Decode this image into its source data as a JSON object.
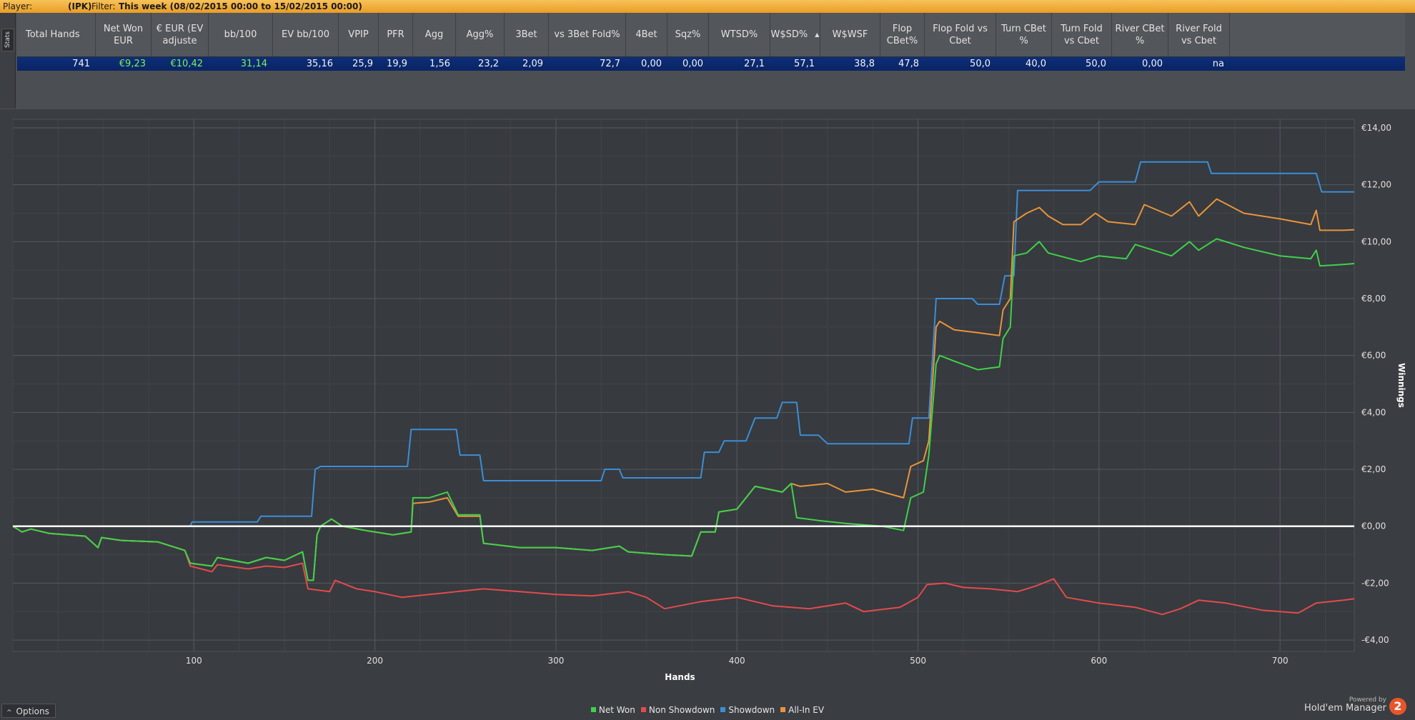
{
  "filter_bar": {
    "player_label": "Player:",
    "player_value": "(IPK)",
    "filter_label": "Filter:",
    "filter_value": "This week (08/02/2015 00:00 to 15/02/2015 00:00)"
  },
  "stats_tab_label": "Stats",
  "stats_table": {
    "columns": [
      {
        "label": "Total Hands",
        "value": "741",
        "green": false
      },
      {
        "label": "Net Won EUR",
        "value": "€9,23",
        "green": true
      },
      {
        "label": "€ EUR (EV adjuste",
        "value": "€10,42",
        "green": true
      },
      {
        "label": "bb/100",
        "value": "31,14",
        "green": true
      },
      {
        "label": "EV bb/100",
        "value": "35,16",
        "green": false
      },
      {
        "label": "VPIP",
        "value": "25,9",
        "green": false
      },
      {
        "label": "PFR",
        "value": "19,9",
        "green": false
      },
      {
        "label": "Agg",
        "value": "1,56",
        "green": false
      },
      {
        "label": "Agg%",
        "value": "23,2",
        "green": false
      },
      {
        "label": "3Bet",
        "value": "2,09",
        "green": false
      },
      {
        "label": "vs 3Bet Fold%",
        "value": "72,7",
        "green": false
      },
      {
        "label": "4Bet",
        "value": "0,00",
        "green": false
      },
      {
        "label": "Sqz%",
        "value": "0,00",
        "green": false
      },
      {
        "label": "WTSD%",
        "value": "27,1",
        "green": false
      },
      {
        "label": "W$SD%",
        "value": "57,1",
        "green": false
      },
      {
        "label": "W$WSF",
        "value": "38,8",
        "green": false
      },
      {
        "label": "Flop CBet%",
        "value": "47,8",
        "green": false
      },
      {
        "label": "Flop Fold vs Cbet",
        "value": "50,0",
        "green": false
      },
      {
        "label": "Turn CBet %",
        "value": "40,0",
        "green": false
      },
      {
        "label": "Turn Fold vs Cbet",
        "value": "50,0",
        "green": false
      },
      {
        "label": "River CBet %",
        "value": "0,00",
        "green": false
      },
      {
        "label": "River Fold vs Cbet",
        "value": "na",
        "green": false
      }
    ]
  },
  "chart_data": {
    "type": "line",
    "title": "",
    "xlabel": "Hands",
    "ylabel": "Winnings",
    "xlim": [
      0,
      741
    ],
    "ylim": [
      -4.4,
      14.3
    ],
    "x_ticks": [
      100,
      200,
      300,
      400,
      500,
      600,
      700
    ],
    "y_ticks": [
      {
        "v": 14,
        "label": "€14,00"
      },
      {
        "v": 12,
        "label": "€12,00"
      },
      {
        "v": 10,
        "label": "€10,00"
      },
      {
        "v": 8,
        "label": "€8,00"
      },
      {
        "v": 6,
        "label": "€6,00"
      },
      {
        "v": 4,
        "label": "€4,00"
      },
      {
        "v": 2,
        "label": "€2,00"
      },
      {
        "v": 0,
        "label": "€0,00"
      },
      {
        "v": -2,
        "label": "-€2,00"
      },
      {
        "v": -4,
        "label": "-€4,00"
      }
    ],
    "grid": true,
    "legend_position": "bottom",
    "series": [
      {
        "name": "Net Won",
        "color": "#3fd14a",
        "points": [
          [
            0,
            0
          ],
          [
            5,
            -0.2
          ],
          [
            10,
            -0.1
          ],
          [
            20,
            -0.25
          ],
          [
            40,
            -0.35
          ],
          [
            47,
            -0.75
          ],
          [
            49,
            -0.4
          ],
          [
            60,
            -0.5
          ],
          [
            80,
            -0.55
          ],
          [
            95,
            -0.85
          ],
          [
            98,
            -1.3
          ],
          [
            110,
            -1.4
          ],
          [
            113,
            -1.1
          ],
          [
            130,
            -1.3
          ],
          [
            140,
            -1.1
          ],
          [
            150,
            -1.2
          ],
          [
            160,
            -0.9
          ],
          [
            163,
            -1.9
          ],
          [
            166,
            -1.9
          ],
          [
            168,
            -0.3
          ],
          [
            170,
            0.0
          ],
          [
            176,
            0.25
          ],
          [
            182,
            0.0
          ],
          [
            195,
            -0.15
          ],
          [
            210,
            -0.3
          ],
          [
            220,
            -0.2
          ],
          [
            221,
            1.0
          ],
          [
            230,
            1.0
          ],
          [
            240,
            1.2
          ],
          [
            246,
            0.4
          ],
          [
            258,
            0.4
          ],
          [
            260,
            -0.6
          ],
          [
            280,
            -0.75
          ],
          [
            300,
            -0.75
          ],
          [
            320,
            -0.85
          ],
          [
            335,
            -0.7
          ],
          [
            340,
            -0.9
          ],
          [
            360,
            -1.0
          ],
          [
            375,
            -1.05
          ],
          [
            380,
            -0.2
          ],
          [
            388,
            -0.2
          ],
          [
            390,
            0.5
          ],
          [
            400,
            0.6
          ],
          [
            405,
            1.0
          ],
          [
            410,
            1.4
          ],
          [
            425,
            1.2
          ],
          [
            430,
            1.5
          ],
          [
            433,
            0.3
          ],
          [
            445,
            0.2
          ],
          [
            460,
            0.1
          ],
          [
            480,
            0.0
          ],
          [
            492,
            -0.15
          ],
          [
            496,
            1.0
          ],
          [
            503,
            1.2
          ],
          [
            506,
            2.5
          ],
          [
            510,
            5.7
          ],
          [
            512,
            6.0
          ],
          [
            520,
            5.8
          ],
          [
            533,
            5.5
          ],
          [
            545,
            5.6
          ],
          [
            547,
            6.6
          ],
          [
            551,
            7.0
          ],
          [
            553,
            9.5
          ],
          [
            560,
            9.6
          ],
          [
            567,
            10.0
          ],
          [
            572,
            9.6
          ],
          [
            578,
            9.5
          ],
          [
            590,
            9.3
          ],
          [
            600,
            9.5
          ],
          [
            615,
            9.4
          ],
          [
            620,
            9.9
          ],
          [
            640,
            9.5
          ],
          [
            650,
            10.0
          ],
          [
            655,
            9.7
          ],
          [
            665,
            10.1
          ],
          [
            680,
            9.8
          ],
          [
            700,
            9.5
          ],
          [
            717,
            9.4
          ],
          [
            720,
            9.7
          ],
          [
            722,
            9.15
          ],
          [
            735,
            9.2
          ],
          [
            741,
            9.23
          ]
        ]
      },
      {
        "name": "Non Showdown",
        "color": "#e24b4b",
        "points": [
          [
            0,
            0
          ],
          [
            5,
            -0.2
          ],
          [
            10,
            -0.1
          ],
          [
            20,
            -0.25
          ],
          [
            40,
            -0.35
          ],
          [
            47,
            -0.75
          ],
          [
            49,
            -0.4
          ],
          [
            60,
            -0.5
          ],
          [
            80,
            -0.55
          ],
          [
            95,
            -0.85
          ],
          [
            98,
            -1.4
          ],
          [
            110,
            -1.6
          ],
          [
            113,
            -1.35
          ],
          [
            130,
            -1.5
          ],
          [
            140,
            -1.4
          ],
          [
            150,
            -1.45
          ],
          [
            160,
            -1.3
          ],
          [
            163,
            -2.2
          ],
          [
            175,
            -2.3
          ],
          [
            178,
            -1.9
          ],
          [
            190,
            -2.2
          ],
          [
            200,
            -2.3
          ],
          [
            215,
            -2.5
          ],
          [
            230,
            -2.4
          ],
          [
            245,
            -2.3
          ],
          [
            260,
            -2.2
          ],
          [
            280,
            -2.3
          ],
          [
            300,
            -2.4
          ],
          [
            320,
            -2.45
          ],
          [
            340,
            -2.3
          ],
          [
            350,
            -2.5
          ],
          [
            360,
            -2.9
          ],
          [
            380,
            -2.65
          ],
          [
            400,
            -2.5
          ],
          [
            420,
            -2.8
          ],
          [
            440,
            -2.9
          ],
          [
            460,
            -2.7
          ],
          [
            470,
            -3.0
          ],
          [
            490,
            -2.85
          ],
          [
            500,
            -2.5
          ],
          [
            505,
            -2.05
          ],
          [
            515,
            -2.0
          ],
          [
            525,
            -2.15
          ],
          [
            540,
            -2.2
          ],
          [
            555,
            -2.3
          ],
          [
            565,
            -2.1
          ],
          [
            575,
            -1.85
          ],
          [
            582,
            -2.5
          ],
          [
            600,
            -2.7
          ],
          [
            620,
            -2.85
          ],
          [
            635,
            -3.1
          ],
          [
            645,
            -2.9
          ],
          [
            655,
            -2.6
          ],
          [
            670,
            -2.7
          ],
          [
            690,
            -2.95
          ],
          [
            700,
            -3.0
          ],
          [
            710,
            -3.05
          ],
          [
            720,
            -2.7
          ],
          [
            735,
            -2.6
          ],
          [
            741,
            -2.55
          ]
        ]
      },
      {
        "name": "Showdown",
        "color": "#3b8ed6",
        "points": [
          [
            0,
            0
          ],
          [
            98,
            0
          ],
          [
            99,
            0.15
          ],
          [
            135,
            0.15
          ],
          [
            137,
            0.35
          ],
          [
            165,
            0.35
          ],
          [
            167,
            2.0
          ],
          [
            170,
            2.1
          ],
          [
            218,
            2.1
          ],
          [
            220,
            3.4
          ],
          [
            245,
            3.4
          ],
          [
            247,
            2.5
          ],
          [
            258,
            2.5
          ],
          [
            260,
            1.6
          ],
          [
            325,
            1.6
          ],
          [
            327,
            2.0
          ],
          [
            335,
            2.0
          ],
          [
            337,
            1.7
          ],
          [
            380,
            1.7
          ],
          [
            382,
            2.6
          ],
          [
            390,
            2.6
          ],
          [
            393,
            3.0
          ],
          [
            405,
            3.0
          ],
          [
            410,
            3.8
          ],
          [
            422,
            3.8
          ],
          [
            425,
            4.35
          ],
          [
            433,
            4.35
          ],
          [
            435,
            3.2
          ],
          [
            445,
            3.2
          ],
          [
            450,
            2.9
          ],
          [
            495,
            2.9
          ],
          [
            497,
            3.8
          ],
          [
            506,
            3.8
          ],
          [
            510,
            8.0
          ],
          [
            530,
            8.0
          ],
          [
            533,
            7.8
          ],
          [
            545,
            7.8
          ],
          [
            548,
            8.8
          ],
          [
            553,
            8.8
          ],
          [
            555,
            11.8
          ],
          [
            595,
            11.8
          ],
          [
            600,
            12.1
          ],
          [
            620,
            12.1
          ],
          [
            623,
            12.8
          ],
          [
            660,
            12.8
          ],
          [
            662,
            12.4
          ],
          [
            720,
            12.4
          ],
          [
            723,
            11.75
          ],
          [
            741,
            11.75
          ]
        ]
      },
      {
        "name": "All-In EV",
        "color": "#e8943a",
        "points": [
          [
            0,
            0
          ],
          [
            5,
            -0.2
          ],
          [
            10,
            -0.1
          ],
          [
            20,
            -0.25
          ],
          [
            40,
            -0.35
          ],
          [
            47,
            -0.75
          ],
          [
            49,
            -0.4
          ],
          [
            60,
            -0.5
          ],
          [
            80,
            -0.55
          ],
          [
            95,
            -0.85
          ],
          [
            98,
            -1.3
          ],
          [
            110,
            -1.4
          ],
          [
            113,
            -1.1
          ],
          [
            130,
            -1.3
          ],
          [
            140,
            -1.1
          ],
          [
            150,
            -1.2
          ],
          [
            160,
            -0.9
          ],
          [
            163,
            -1.9
          ],
          [
            166,
            -1.9
          ],
          [
            168,
            -0.3
          ],
          [
            170,
            0.0
          ],
          [
            176,
            0.25
          ],
          [
            182,
            0.0
          ],
          [
            195,
            -0.15
          ],
          [
            210,
            -0.3
          ],
          [
            220,
            -0.2
          ],
          [
            221,
            0.8
          ],
          [
            230,
            0.85
          ],
          [
            240,
            1.0
          ],
          [
            246,
            0.35
          ],
          [
            258,
            0.35
          ],
          [
            260,
            -0.6
          ],
          [
            280,
            -0.75
          ],
          [
            300,
            -0.75
          ],
          [
            320,
            -0.85
          ],
          [
            335,
            -0.7
          ],
          [
            340,
            -0.9
          ],
          [
            360,
            -1.0
          ],
          [
            375,
            -1.05
          ],
          [
            380,
            -0.2
          ],
          [
            388,
            -0.2
          ],
          [
            390,
            0.5
          ],
          [
            400,
            0.6
          ],
          [
            405,
            1.0
          ],
          [
            410,
            1.4
          ],
          [
            425,
            1.2
          ],
          [
            430,
            1.5
          ],
          [
            435,
            1.4
          ],
          [
            450,
            1.5
          ],
          [
            460,
            1.2
          ],
          [
            475,
            1.3
          ],
          [
            492,
            1.0
          ],
          [
            496,
            2.1
          ],
          [
            503,
            2.3
          ],
          [
            506,
            3.0
          ],
          [
            510,
            7.0
          ],
          [
            512,
            7.2
          ],
          [
            520,
            6.9
          ],
          [
            533,
            6.8
          ],
          [
            545,
            6.7
          ],
          [
            547,
            7.6
          ],
          [
            551,
            8.0
          ],
          [
            553,
            10.7
          ],
          [
            560,
            11.0
          ],
          [
            567,
            11.2
          ],
          [
            572,
            10.9
          ],
          [
            580,
            10.6
          ],
          [
            590,
            10.6
          ],
          [
            598,
            11.0
          ],
          [
            605,
            10.7
          ],
          [
            620,
            10.6
          ],
          [
            625,
            11.3
          ],
          [
            640,
            10.9
          ],
          [
            650,
            11.4
          ],
          [
            655,
            10.9
          ],
          [
            665,
            11.5
          ],
          [
            680,
            11.0
          ],
          [
            700,
            10.8
          ],
          [
            717,
            10.6
          ],
          [
            720,
            11.1
          ],
          [
            722,
            10.4
          ],
          [
            735,
            10.4
          ],
          [
            741,
            10.42
          ]
        ]
      }
    ],
    "zero_line": 0
  },
  "options_label": "Options",
  "powered_by": {
    "line1": "Powered by",
    "brand": "Hold'em Manager",
    "badge": "2"
  }
}
